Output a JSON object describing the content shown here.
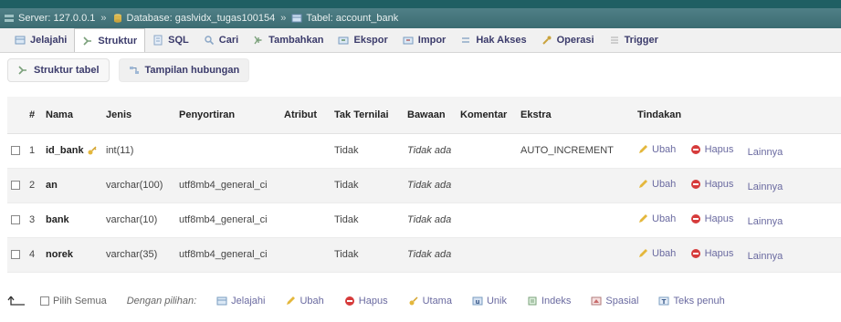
{
  "breadcrumb": {
    "server": "Server: 127.0.0.1",
    "database": "Database: gaslvidx_tugas100154",
    "table": "Tabel: account_bank",
    "separator": "»"
  },
  "tabs": [
    {
      "label": "Jelajahi",
      "icon": "table-icon"
    },
    {
      "label": "Struktur",
      "icon": "structure-icon",
      "active": true
    },
    {
      "label": "SQL",
      "icon": "sql-icon"
    },
    {
      "label": "Cari",
      "icon": "search-icon"
    },
    {
      "label": "Tambahkan",
      "icon": "insert-icon"
    },
    {
      "label": "Ekspor",
      "icon": "export-icon"
    },
    {
      "label": "Impor",
      "icon": "import-icon"
    },
    {
      "label": "Hak Akses",
      "icon": "privileges-icon"
    },
    {
      "label": "Operasi",
      "icon": "wrench-icon"
    },
    {
      "label": "Trigger",
      "icon": "trigger-icon"
    }
  ],
  "subtabs": [
    {
      "label": "Struktur tabel",
      "icon": "structure-icon"
    },
    {
      "label": "Tampilan hubungan",
      "icon": "relation-icon"
    }
  ],
  "columns": [
    "#",
    "Nama",
    "Jenis",
    "Penyortiran",
    "Atribut",
    "Tak Ternilai",
    "Bawaan",
    "Komentar",
    "Ekstra",
    "Tindakan"
  ],
  "rows": [
    {
      "num": "1",
      "name": "id_bank",
      "key": true,
      "type": "int(11)",
      "collation": "",
      "attr": "",
      "null": "Tidak",
      "default": "Tidak ada",
      "comment": "",
      "extra": "AUTO_INCREMENT"
    },
    {
      "num": "2",
      "name": "an",
      "key": false,
      "type": "varchar(100)",
      "collation": "utf8mb4_general_ci",
      "attr": "",
      "null": "Tidak",
      "default": "Tidak ada",
      "comment": "",
      "extra": ""
    },
    {
      "num": "3",
      "name": "bank",
      "key": false,
      "type": "varchar(10)",
      "collation": "utf8mb4_general_ci",
      "attr": "",
      "null": "Tidak",
      "default": "Tidak ada",
      "comment": "",
      "extra": ""
    },
    {
      "num": "4",
      "name": "norek",
      "key": false,
      "type": "varchar(35)",
      "collation": "utf8mb4_general_ci",
      "attr": "",
      "null": "Tidak",
      "default": "Tidak ada",
      "comment": "",
      "extra": ""
    }
  ],
  "actions": {
    "edit": "Ubah",
    "drop": "Hapus",
    "more": "Lainnya"
  },
  "footer": {
    "check_all": "Pilih Semua",
    "with_selected": "Dengan pilihan:",
    "items": [
      {
        "label": "Jelajahi",
        "icon": "table-icon"
      },
      {
        "label": "Ubah",
        "icon": "pencil-icon"
      },
      {
        "label": "Hapus",
        "icon": "delete-icon"
      },
      {
        "label": "Utama",
        "icon": "key-icon"
      },
      {
        "label": "Unik",
        "icon": "unique-icon"
      },
      {
        "label": "Indeks",
        "icon": "index-icon"
      },
      {
        "label": "Spasial",
        "icon": "spatial-icon"
      },
      {
        "label": "Teks penuh",
        "icon": "fulltext-icon"
      }
    ]
  },
  "colors": {
    "header_bar": "#3c6c72",
    "link": "#3b3b6b",
    "delete_red": "#d63b3b",
    "pencil_yellow": "#e4b73c"
  }
}
